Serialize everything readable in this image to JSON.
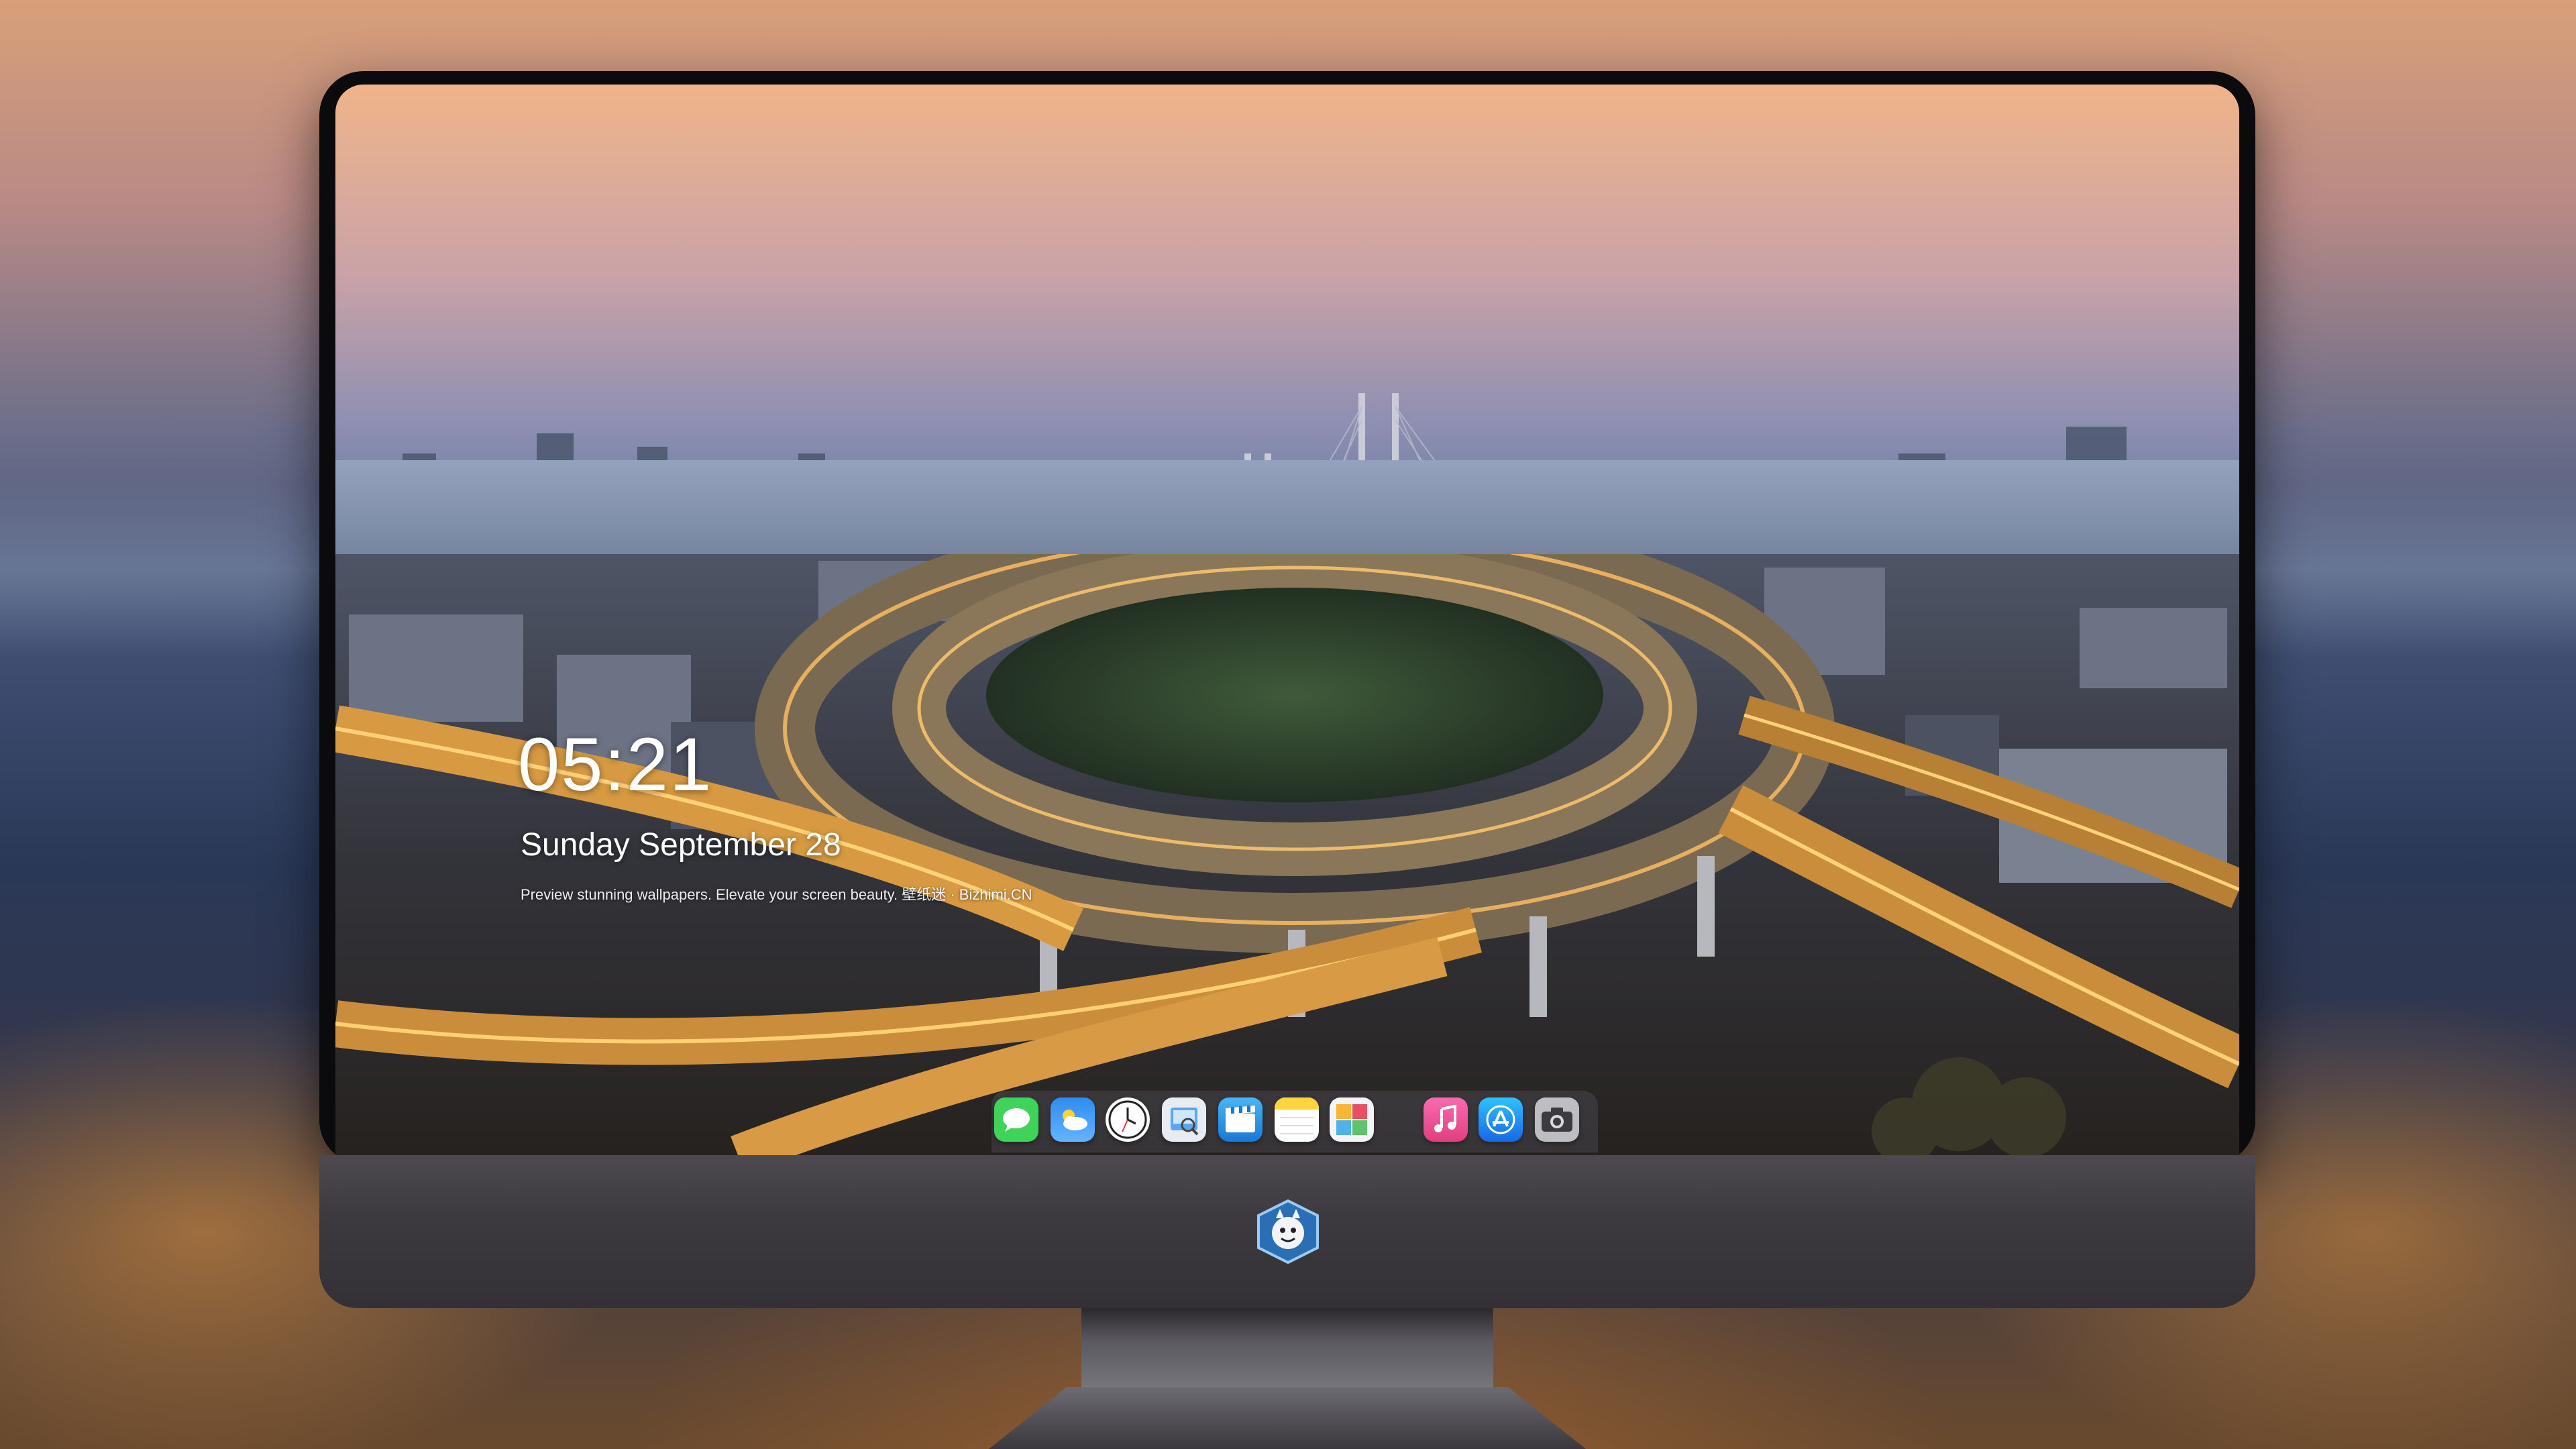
{
  "lock_screen": {
    "time": "05:21",
    "date": "Sunday September  28",
    "tagline": "Preview stunning wallpapers. Elevate your screen beauty. 壁纸迷 · Bizhimi.CN"
  },
  "dock": {
    "apps": [
      {
        "icon": "messages-icon"
      },
      {
        "icon": "weather-icon"
      },
      {
        "icon": "clock-icon"
      },
      {
        "icon": "preview-icon"
      },
      {
        "icon": "clips-icon"
      },
      {
        "icon": "notes-icon"
      },
      {
        "icon": "photo-booth-icon"
      },
      {
        "icon": "music-icon"
      },
      {
        "icon": "app-store-icon"
      },
      {
        "icon": "camera-icon"
      }
    ]
  },
  "colors": {
    "messages": "#3fd35a",
    "weather": "#2e8cf0",
    "music": "#f04f9a",
    "app_store": "#2b8ff6",
    "camera": "#8d8d93",
    "notes": "#ffd43d"
  }
}
